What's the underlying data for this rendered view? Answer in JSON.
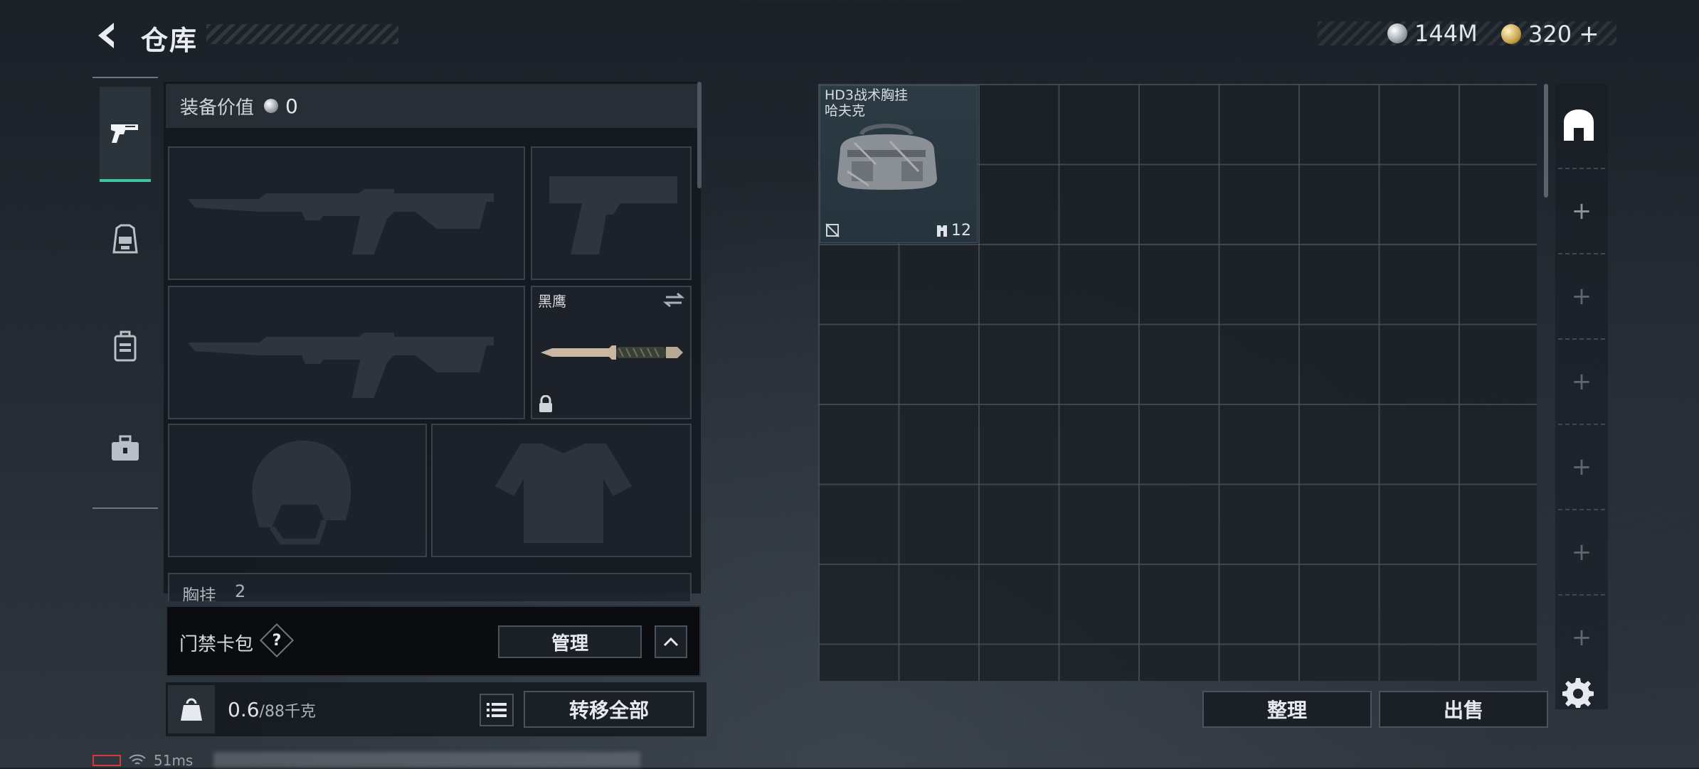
{
  "header": {
    "title": "仓库",
    "currency": [
      {
        "icon": "silver-coin-icon",
        "value": "144M"
      },
      {
        "icon": "gold-coin-icon",
        "value": "320",
        "add": "+"
      }
    ]
  },
  "tabs": [
    {
      "name": "tab-weapons",
      "icon": "pistol-icon",
      "active": true
    },
    {
      "name": "tab-chest-rig",
      "icon": "chest-rig-icon",
      "active": false
    },
    {
      "name": "tab-backpack",
      "icon": "backpack-icon",
      "active": false
    },
    {
      "name": "tab-toolbox",
      "icon": "toolbox-icon",
      "active": false
    }
  ],
  "loadout": {
    "equip_value_label": "装备价值",
    "equip_value": "0",
    "knife_name": "黑鹰",
    "next_section_label": "胸挂",
    "next_section_count": "2"
  },
  "keycard": {
    "label": "门禁卡包",
    "help": "?",
    "manage": "管理"
  },
  "weight": {
    "current": "0.6",
    "capacity": "/88千克",
    "kg_icon_label": "KG"
  },
  "actions": {
    "transfer_all": "转移全部",
    "organize": "整理",
    "sell": "出售"
  },
  "stash_item": {
    "name_line1": "HD3战术胸挂",
    "name_line2": "哈夫克",
    "count": "12"
  },
  "status": {
    "ping": "51ms"
  },
  "colors": {
    "accent": "#3fc6a0",
    "panel": "#14191f",
    "border": "#4a525b"
  }
}
